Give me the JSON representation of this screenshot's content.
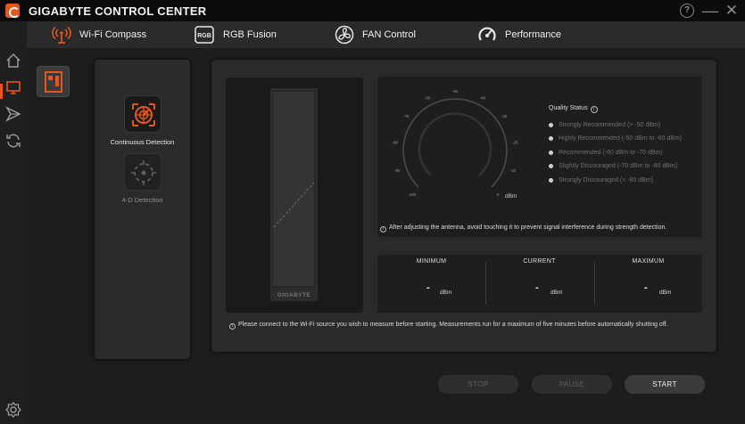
{
  "app": {
    "title": "GIGABYTE CONTROL CENTER"
  },
  "colors": {
    "accent": "#e4561b",
    "background": "#121212",
    "panel": "#2a2a2a"
  },
  "window_controls": {
    "help": "?",
    "minimize": "—",
    "close": "✕"
  },
  "tabs": [
    {
      "label": "Wi-Fi Compass",
      "icon": "wifi-antenna-icon",
      "active": true
    },
    {
      "label": "RGB Fusion",
      "icon": "rgb-icon",
      "active": false
    },
    {
      "label": "FAN Control",
      "icon": "fan-icon",
      "active": false
    },
    {
      "label": "Performance",
      "icon": "gauge-icon",
      "active": false
    }
  ],
  "nav": [
    {
      "icon": "home-icon"
    },
    {
      "icon": "monitor-icon",
      "active": true
    },
    {
      "icon": "flash-icon"
    },
    {
      "icon": "refresh-icon"
    },
    {
      "icon": "settings-icon"
    }
  ],
  "modes": [
    {
      "label": "Continuous Detection",
      "icon": "radar-icon",
      "active": true
    },
    {
      "label": "4-D Detection",
      "icon": "compass-icon",
      "active": false
    }
  ],
  "antenna": {
    "logo": "GIGABYTE"
  },
  "gauge": {
    "ticks": [
      "-100",
      "-90",
      "-80",
      "-70",
      "-60",
      "-50",
      "-40",
      "-30",
      "-20",
      "-10",
      "0"
    ],
    "unit": "dBm",
    "note": "After adjusting the antenna, avoid touching it to prevent signal interference during strength detection."
  },
  "quality": {
    "title": "Quality Status",
    "items": [
      "Strongly Recommended (> -50 dBm)",
      "Highly Recommended (-50 dBm to -60 dBm)",
      "Recommended (-60 dBm to -70 dBm)",
      "Slightly Discouraged (-70 dBm to -80 dBm)",
      "Strongly Discouraged (< -80 dBm)"
    ]
  },
  "stats": {
    "minimum": {
      "label": "MINIMUM",
      "value": "-",
      "unit": "dBm"
    },
    "current": {
      "label": "CURRENT",
      "value": "-",
      "unit": "dBm"
    },
    "maximum": {
      "label": "MAXIMUM",
      "value": "-",
      "unit": "dBm"
    }
  },
  "bottom_note": "Please connect to the Wi-Fi source you wish to measure before starting. Measurements run for a maximum of five minutes before automatically shutting off.",
  "buttons": {
    "stop": "STOP",
    "pause": "PAUSE",
    "start": "START"
  }
}
